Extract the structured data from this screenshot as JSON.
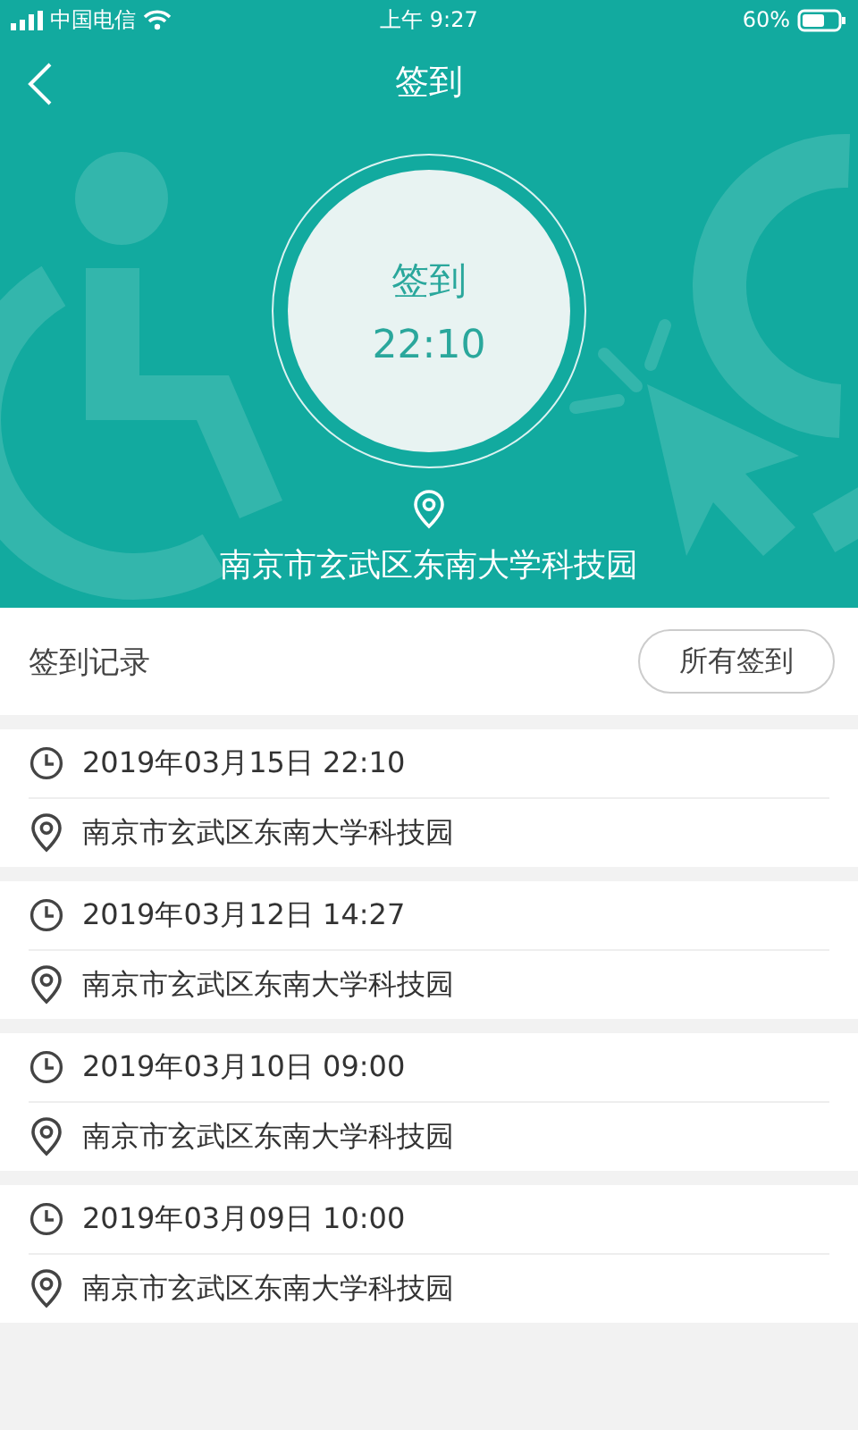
{
  "status_bar": {
    "carrier": "中国电信",
    "time": "上午 9:27",
    "battery": "60%"
  },
  "nav": {
    "title": "签到"
  },
  "hero": {
    "button_label": "签到",
    "button_time": "22:10",
    "location": "南京市玄武区东南大学科技园"
  },
  "records_header": {
    "title": "签到记录",
    "button": "所有签到"
  },
  "records": [
    {
      "time": "2019年03月15日 22:10",
      "location": "南京市玄武区东南大学科技园"
    },
    {
      "time": "2019年03月12日 14:27",
      "location": "南京市玄武区东南大学科技园"
    },
    {
      "time": "2019年03月10日 09:00",
      "location": "南京市玄武区东南大学科技园"
    },
    {
      "time": "2019年03月09日 10:00",
      "location": "南京市玄武区东南大学科技园"
    }
  ]
}
